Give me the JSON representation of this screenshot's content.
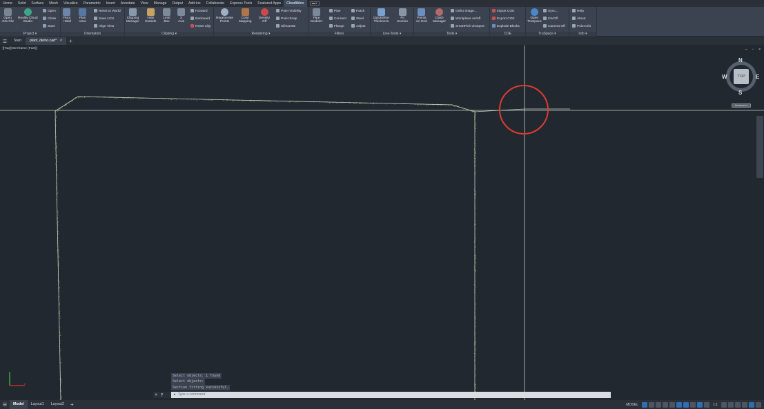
{
  "menu_tabs": [
    "Home",
    "Solid",
    "Surface",
    "Mesh",
    "Visualize",
    "Parametric",
    "Insert",
    "Annotate",
    "View",
    "Manage",
    "Output",
    "Add-ins",
    "Collaborate",
    "Express Tools",
    "Featured Apps",
    "CloudWorx"
  ],
  "active_menu_tab": "CloudWorx",
  "ribbon": {
    "project": {
      "title": "Project ▾",
      "open_file": "Open\n.03x File",
      "reality_cloud": "Reality Cloud\nStudio",
      "open": "Open",
      "close": "Close",
      "save": "Save"
    },
    "orientation": {
      "title": "Orientation",
      "floor_wall": "Floor\n+Wall",
      "plan_view": "Plan\nView",
      "reset_world": "Reset to World",
      "save_ucs": "Save UCS",
      "align_view": "Align View"
    },
    "clipping": {
      "title": "Clipping ▾",
      "clipping_manager": "Clipping\nManager",
      "hide_outside": "Hide\nOutside",
      "limit_box": "Limit\nBox",
      "x_axis": "X\nAxis",
      "forward": "Forward",
      "backward": "Backward",
      "reset_clip": "Reset Clip"
    },
    "rendering": {
      "title": "Rendering ▾",
      "regenerate": "Regenerate\nPoints",
      "color_mapping": "Color\nMapping",
      "density_off": "Density\nOff",
      "point_visibility": "Point Visibility",
      "point_snap": "Point Snap",
      "silhouette": "Silhouette"
    },
    "filters": {
      "title": "Filters",
      "pipe_modeler": "Pipe\nModeler",
      "pipe": "Pipe",
      "connect": "Connect",
      "flange": "Flange",
      "patch": "Patch",
      "steel": "Steel",
      "adjust": "Adjust"
    },
    "line_tools": {
      "title": "Line-Tools ▾",
      "quickslice": "QuickSlice\nThickness",
      "fit_section": "Fit\nSection"
    },
    "tools": {
      "title": "Tools ▾",
      "points_on_grid": "Points\non Grid",
      "clash_manager": "Clash\nManager",
      "ortho_image": "Ortho Image...",
      "workplane": "Workplane on/off",
      "smartpick": "SmartPick Viewport"
    },
    "coe": {
      "title": "COE",
      "import_coe": "Import COE",
      "export_coe": "Export COE",
      "explode_blocks": "Explode Blocks"
    },
    "truspace": {
      "title": "TruSpace ▾",
      "open_truspace": "Open\nTruSpace",
      "sync": "Sync...",
      "on_off": "On/Off",
      "camera_off": "Camera Off"
    },
    "info": {
      "title": "Info ▾",
      "help": "Help",
      "about": "About",
      "point_info": "Point Info"
    }
  },
  "file_tabs": {
    "start": "Start",
    "active_file": "plant_demo.cad*"
  },
  "viewport": {
    "label": "-][Top][Wireframe (Fast)]",
    "controls": "– ▫ ×"
  },
  "viewcube": {
    "n": "N",
    "s": "S",
    "e": "E",
    "w": "W",
    "face": "TOP",
    "wcs": "Unnamed ▾"
  },
  "command_history": [
    "Select objects: 1 found",
    "Select objects:",
    "Section fitting successful."
  ],
  "command_placeholder": "Type a command",
  "command_prompt": "▸",
  "layout_tabs": [
    "Model",
    "Layout1",
    "Layout2"
  ],
  "active_layout": "Model",
  "status": {
    "model": "MODEL",
    "scale": "1:1"
  },
  "colors": {
    "highlight_circle": "#e03b30",
    "edge_line": "#c8d1c2",
    "scan_dots": "#6f8a4a",
    "ucs_green": "#3fb03f",
    "ucs_red": "#c03030",
    "accent": "#2f6fb0"
  }
}
